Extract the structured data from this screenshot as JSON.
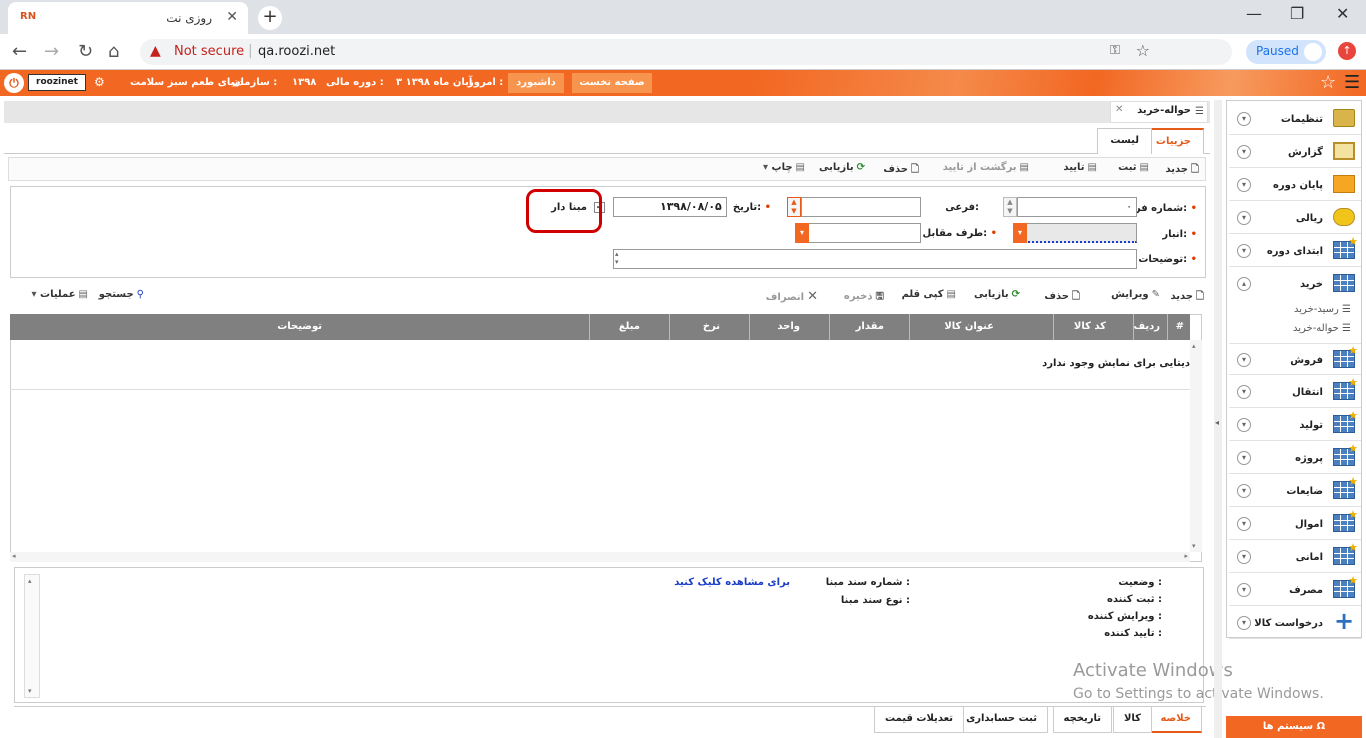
{
  "browser": {
    "tab_title": "روزی نت",
    "favicon_text": "RN",
    "url": "qa.roozi.net",
    "security_label": "Not secure",
    "profile_status": "Paused"
  },
  "header": {
    "username": "roozinet",
    "org_label": "سازمان :",
    "org_name": "دنیای طعم سبز سلامت",
    "fiscal_label": "دوره مالی :",
    "fiscal_year": "۱۳۹۸",
    "today_label": "امروز :",
    "today_value": "۳ آبان ماه ۱۳۹۸",
    "dashboard_btn": "داشبورد",
    "home_btn": "صفحه نخست"
  },
  "window": {
    "title": "حواله-خرید"
  },
  "subtabs": {
    "details": "جزییات",
    "list": "لیست"
  },
  "toolbar": {
    "new": "جدید",
    "save": "ثبت",
    "approve": "تایید",
    "unapprove": "برگشت از تایید",
    "delete": "حذف",
    "refresh": "بازیابی",
    "print": "چاپ"
  },
  "form": {
    "form_number_label": "شماره فرم:",
    "form_number_value": "۰",
    "sub_label": "فرعی:",
    "date_label": "تاریخ:",
    "date_value": "۱۳۹۸/۰۸/۰۵",
    "base_checkbox_label": "مبنا دار",
    "base_checkbox_checked": true,
    "warehouse_label": "انبار:",
    "counterparty_label": "طرف مقابل:",
    "description_label": "توضیحات:"
  },
  "grid_toolbar": {
    "new": "جدید",
    "edit": "ویرایش",
    "delete": "حذف",
    "refresh": "بازیابی",
    "copy_item": "کپی قلم",
    "save": "ذخیره",
    "cancel": "انصراف",
    "search": "جستجو",
    "operations": "عملیات"
  },
  "grid": {
    "columns": [
      "#",
      "ردیف",
      "کد کالا",
      "عنوان کالا",
      "مقدار",
      "واحد",
      "نرخ",
      "مبلغ",
      "توضیحات"
    ],
    "empty_message": "دیتایی برای نمایش وجود ندارد"
  },
  "summary": {
    "status_label": "وضعیت :",
    "registrar_label": "ثبت کننده :",
    "editor_label": "ویرایش کننده :",
    "approver_label": "تایید کننده :",
    "base_doc_number_label": "شماره سند مبنا :",
    "base_doc_type_label": "نوع سند مبنا :",
    "view_link": "برای مشاهده کلیک کنید"
  },
  "bottom_tabs": [
    "خلاصه",
    "کالا",
    "تاریخچه",
    "ثبت حسابداری",
    "تعدیلات قیمت"
  ],
  "sidebar": {
    "items": [
      {
        "label": "تنظیمات",
        "icon": "settings-folder-icon"
      },
      {
        "label": "گزارش",
        "icon": "clipboard-icon"
      },
      {
        "label": "پایان دوره",
        "icon": "stack-icon"
      },
      {
        "label": "ریالی",
        "icon": "coins-icon"
      },
      {
        "label": "ابتدای دوره",
        "icon": "grid-star-icon"
      },
      {
        "label": "خرید",
        "icon": "grid-icon"
      },
      {
        "label": "فروش",
        "icon": "grid-star-icon"
      },
      {
        "label": "انتقال",
        "icon": "grid-star-icon"
      },
      {
        "label": "تولید",
        "icon": "grid-star-icon"
      },
      {
        "label": "پروژه",
        "icon": "grid-star-icon"
      },
      {
        "label": "ضایعات",
        "icon": "grid-star-icon"
      },
      {
        "label": "اموال",
        "icon": "grid-star-icon"
      },
      {
        "label": "امانی",
        "icon": "grid-star-icon"
      },
      {
        "label": "مصرف",
        "icon": "grid-star-icon"
      },
      {
        "label": "درخواست کالا",
        "icon": "plus-icon"
      }
    ],
    "purchase_subitems": [
      "رسید-خرید",
      "حواله-خرید"
    ],
    "system_button": "سیستم ها"
  },
  "watermark": {
    "line1": "Activate Windows",
    "line2": "Go to Settings to activate Windows."
  }
}
